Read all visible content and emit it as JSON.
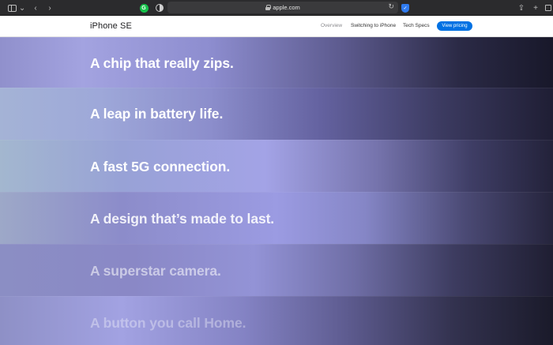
{
  "browser": {
    "url": "apple.com",
    "icons": [
      "sidebar-icon",
      "chevron-down-icon",
      "back-arrow-icon",
      "forward-arrow-icon",
      "grammarly-icon",
      "shield-half-icon",
      "lock-icon",
      "reload-icon",
      "extension-shield-icon",
      "share-icon",
      "new-tab-icon",
      "tab-overview-icon"
    ],
    "icon_glyphs": {
      "caret": "⌄",
      "back": "‹",
      "forward": "›",
      "g": "G",
      "reload": "↻",
      "share": "⇪",
      "newtab": "+",
      "ext": "✓"
    }
  },
  "site_nav": {
    "title": "iPhone SE",
    "links": [
      "Overview",
      "Switching to iPhone",
      "Tech Specs"
    ],
    "cta": "View pricing",
    "cta_color": "#0071e3"
  },
  "features": [
    "A chip that really zips.",
    "A leap in battery life.",
    "A fast 5G connection.",
    "A design that’s made to last.",
    "A superstar camera.",
    "A button you call Home."
  ]
}
